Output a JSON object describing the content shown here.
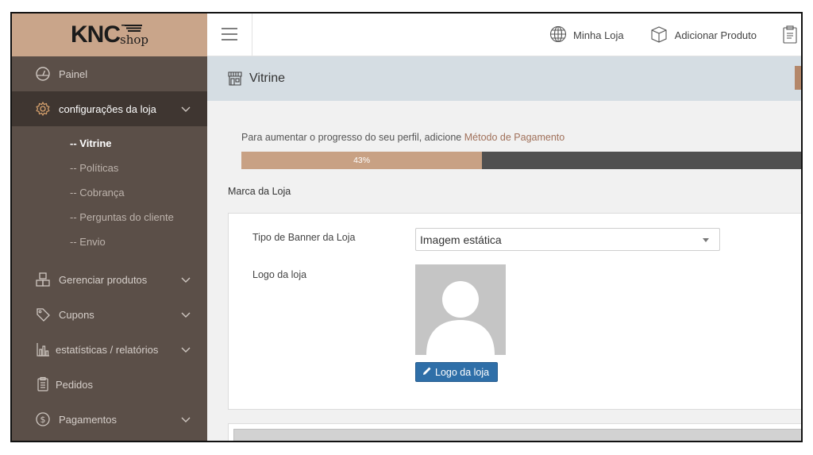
{
  "brand": {
    "logo_main": "KNC",
    "logo_sub": "shop"
  },
  "sidebar": {
    "items": [
      {
        "label": "Painel",
        "icon": "dashboard-icon"
      },
      {
        "label": "configurações da loja",
        "icon": "settings-icon",
        "active": true,
        "subitems": [
          {
            "label": "-- Vitrine",
            "current": true
          },
          {
            "label": "-- Políticas"
          },
          {
            "label": "-- Cobrança"
          },
          {
            "label": "-- Perguntas do cliente"
          },
          {
            "label": "-- Envio"
          }
        ]
      },
      {
        "label": "Gerenciar produtos",
        "icon": "boxes-icon"
      },
      {
        "label": "Cupons",
        "icon": "tag-icon"
      },
      {
        "label": "estatísticas / relatórios",
        "icon": "bar-chart-icon"
      },
      {
        "label": "Pedidos",
        "icon": "clipboard-icon"
      },
      {
        "label": "Pagamentos",
        "icon": "dollar-circle-icon"
      }
    ]
  },
  "topbar": {
    "links": [
      {
        "label": "Minha Loja",
        "icon": "globe-icon"
      },
      {
        "label": "Adicionar Produto",
        "icon": "box-icon"
      }
    ]
  },
  "page": {
    "title": "Vitrine",
    "icon": "storefront-icon"
  },
  "progress": {
    "hint_prefix": "Para aumentar o progresso do seu perfil, adicione ",
    "hint_link": "Método de Pagamento",
    "percent_label": "43%",
    "percent_value": 43
  },
  "section": {
    "label": "Marca da Loja"
  },
  "form": {
    "banner_type_label": "Tipo de Banner da Loja",
    "banner_type_value": "Imagem estática",
    "logo_label": "Logo da loja",
    "logo_button": "Logo da loja"
  },
  "colors": {
    "sidebar_bg": "#5b4f48",
    "sidebar_active": "#3f3631",
    "brand_bg": "#c9a58a",
    "progress_fill": "#c8a184",
    "progress_track": "#505050",
    "titlebar_bg": "#d5dde3",
    "button_primary": "#2f6fa8",
    "accent_text": "#a0705a"
  }
}
